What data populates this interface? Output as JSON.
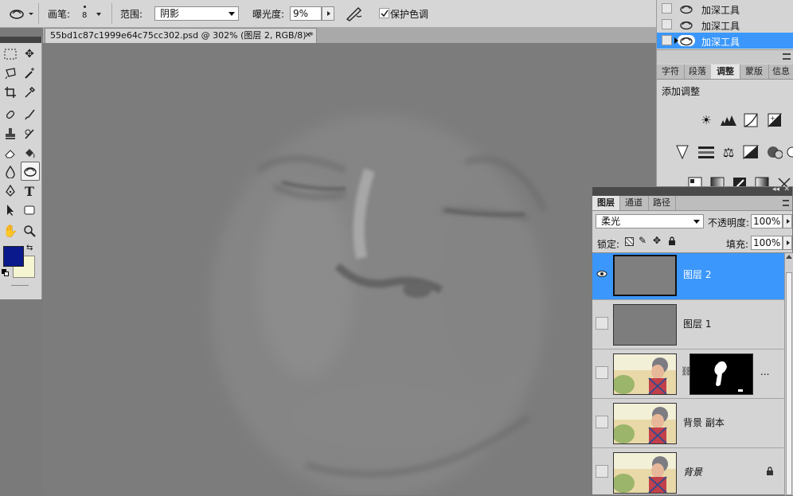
{
  "options_bar": {
    "brush_label": "画笔:",
    "brush_size": "8",
    "range_label": "范围:",
    "range_value": "阴影",
    "exposure_label": "曝光度:",
    "exposure_value": "9%",
    "protect_tones_label": "保护色调"
  },
  "document": {
    "tab_title": "55bd1c87c1999e64c75cc302.psd @ 302% (图层 2, RGB/8) *",
    "close_glyph": "✕"
  },
  "tools": {
    "foreground_color": "#0a1a8c",
    "background_color": "#f5f5d2"
  },
  "history": {
    "items": [
      {
        "label": "加深工具",
        "selected": false
      },
      {
        "label": "加深工具",
        "selected": false
      },
      {
        "label": "加深工具",
        "selected": true
      }
    ]
  },
  "adjust_panel": {
    "tabs": [
      "字符",
      "段落",
      "调整",
      "蒙版",
      "信息"
    ],
    "active_tab": "调整",
    "title": "添加调整"
  },
  "layers_panel": {
    "tabs": [
      "图层",
      "通道",
      "路径"
    ],
    "blend_mode": "柔光",
    "opacity_label": "不透明度:",
    "opacity_value": "100%",
    "lock_label": "锁定:",
    "fill_label": "填充:",
    "fill_value": "100%",
    "layers": [
      {
        "name": "图层 2",
        "selected": true,
        "visible": true
      },
      {
        "name": "图层 1",
        "selected": false,
        "visible": false
      },
      {
        "name": "",
        "selected": false,
        "visible": false
      },
      {
        "name": "背景 副本",
        "selected": false,
        "visible": false
      },
      {
        "name": "背景",
        "selected": false,
        "visible": false
      }
    ],
    "mask_more": "..."
  },
  "colors": {
    "selection_blue": "#3b97fb",
    "panel_gray": "#d4d4d4"
  }
}
